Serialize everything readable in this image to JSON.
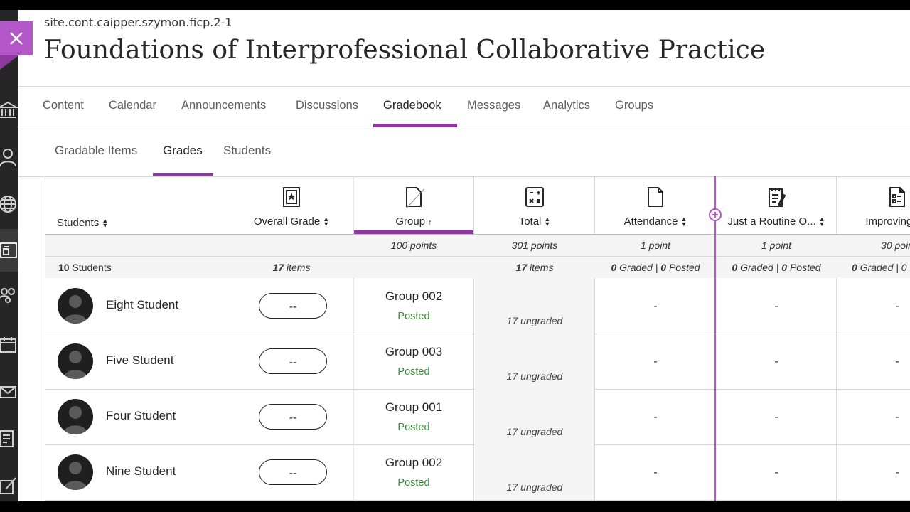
{
  "course": {
    "id": "site.cont.caipper.szymon.ficp.2-1",
    "title": "Foundations of Interprofessional Collaborative Practice"
  },
  "main_nav": {
    "tabs": [
      "Content",
      "Calendar",
      "Announcements",
      "Discussions",
      "Gradebook",
      "Messages",
      "Analytics",
      "Groups"
    ],
    "active": "Gradebook"
  },
  "sub_nav": {
    "tabs": [
      "Gradable Items",
      "Grades",
      "Students"
    ],
    "active": "Grades"
  },
  "grid": {
    "columns": {
      "students": "Students",
      "overall": "Overall Grade",
      "group": "Group",
      "total": "Total",
      "attendance": "Attendance",
      "routine": "Just a Routine O...",
      "improving": "Improving He"
    },
    "points": {
      "group": "100 points",
      "total": "301 points",
      "attendance": "1 point",
      "routine": "1 point",
      "improving": "30 poin"
    },
    "summary": {
      "students_count": "10",
      "students_label": "Students",
      "overall_count": "17",
      "overall_label": "items",
      "total_count": "17",
      "total_label": "items",
      "graded_num": "0",
      "graded_label": "Graded",
      "sep": "|",
      "posted_num": "0",
      "posted_label": "Posted",
      "improving_graded": "Graded | 0"
    },
    "rows": [
      {
        "name": "Eight Student",
        "grade": "--",
        "group": "Group 002",
        "status": "Posted",
        "ungraded": "17 ungraded",
        "attendance": "-",
        "routine": "-",
        "improving": "-"
      },
      {
        "name": "Five Student",
        "grade": "--",
        "group": "Group 003",
        "status": "Posted",
        "ungraded": "17 ungraded",
        "attendance": "-",
        "routine": "-",
        "improving": "-"
      },
      {
        "name": "Four Student",
        "grade": "--",
        "group": "Group 001",
        "status": "Posted",
        "ungraded": "17 ungraded",
        "attendance": "-",
        "routine": "-",
        "improving": "-"
      },
      {
        "name": "Nine Student",
        "grade": "--",
        "group": "Group 002",
        "status": "Posted",
        "ungraded": "17 ungraded",
        "attendance": "-",
        "routine": "-",
        "improving": "-"
      }
    ]
  },
  "colors": {
    "accent": "#8c3aa0",
    "close_bg": "#b457c9",
    "posted": "#3b8a3b",
    "rail": "#262626"
  },
  "icons": {
    "close": "close-icon",
    "rail": [
      "institution-icon",
      "profile-icon",
      "globe-icon",
      "courses-icon",
      "groups-icon",
      "calendar-icon",
      "messages-icon",
      "grades-icon",
      "tools-icon"
    ]
  }
}
